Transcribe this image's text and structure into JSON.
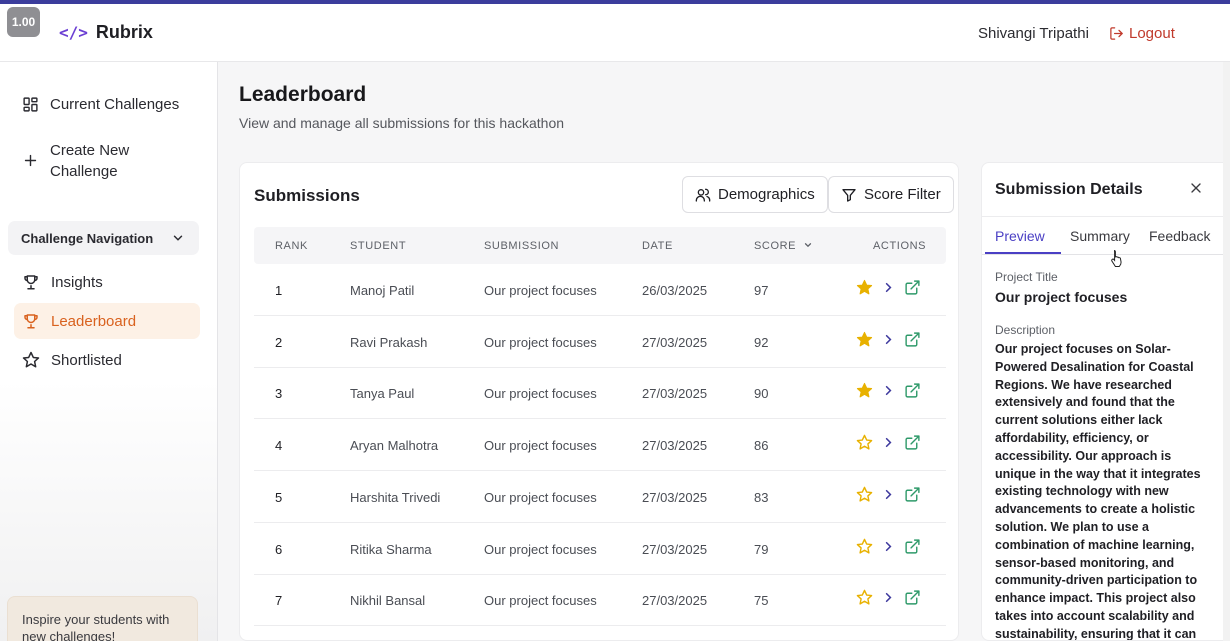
{
  "zoom": "1.00",
  "app": {
    "name": "Rubrix",
    "logo_glyph": "</>"
  },
  "header": {
    "user_name": "Shivangi Tripathi",
    "logout_label": "Logout"
  },
  "sidebar": {
    "current_challenges": "Current Challenges",
    "create_new_line1": "Create New",
    "create_new_line2": "Challenge",
    "nav_group_label": "Challenge Navigation",
    "items": [
      {
        "label": "Insights",
        "icon": "trophy-icon"
      },
      {
        "label": "Leaderboard",
        "icon": "trophy-icon",
        "active": true
      },
      {
        "label": "Shortlisted",
        "icon": "star-icon"
      }
    ],
    "promo_line1": "Inspire your students with",
    "promo_line2": "new challenges!"
  },
  "page": {
    "title": "Leaderboard",
    "subtitle": "View and manage all submissions for this hackathon"
  },
  "submissions": {
    "title": "Submissions",
    "demographics_label": "Demographics",
    "score_filter_label": "Score Filter",
    "columns": [
      "Rank",
      "Student",
      "Submission",
      "Date",
      "Score",
      "Actions"
    ],
    "rows": [
      {
        "rank": "1",
        "student": "Manoj Patil",
        "submission": "Our project focuses",
        "date": "26/03/2025",
        "score": "97",
        "starred": true
      },
      {
        "rank": "2",
        "student": "Ravi Prakash",
        "submission": "Our project focuses",
        "date": "27/03/2025",
        "score": "92",
        "starred": true
      },
      {
        "rank": "3",
        "student": "Tanya Paul",
        "submission": "Our project focuses",
        "date": "27/03/2025",
        "score": "90",
        "starred": true
      },
      {
        "rank": "4",
        "student": "Aryan Malhotra",
        "submission": "Our project focuses",
        "date": "27/03/2025",
        "score": "86",
        "starred": false
      },
      {
        "rank": "5",
        "student": "Harshita Trivedi",
        "submission": "Our project focuses",
        "date": "27/03/2025",
        "score": "83",
        "starred": false
      },
      {
        "rank": "6",
        "student": "Ritika Sharma",
        "submission": "Our project focuses",
        "date": "27/03/2025",
        "score": "79",
        "starred": false
      },
      {
        "rank": "7",
        "student": "Nikhil Bansal",
        "submission": "Our project focuses",
        "date": "27/03/2025",
        "score": "75",
        "starred": false
      }
    ]
  },
  "details": {
    "title": "Submission Details",
    "tabs": [
      "Preview",
      "Summary",
      "Feedback"
    ],
    "active_tab": "Preview",
    "project_title_label": "Project Title",
    "project_title": "Our project focuses",
    "description_label": "Description",
    "description": "Our project focuses on Solar-Powered Desalination for Coastal Regions. We have researched extensively and found that the current solutions either lack affordability, efficiency, or accessibility. Our approach is unique in the way that it integrates existing technology with new advancements to create a holistic solution. We plan to use a combination of machine learning, sensor-based monitoring, and community-driven participation to enhance impact. This project also takes into account scalability and sustainability, ensuring that it can be implemented in various regions"
  },
  "colors": {
    "accent": "#4a3fc4",
    "active_nav": "#d9621f",
    "logout": "#c0392b",
    "star": "#e8b100",
    "external_link": "#2f9a6a"
  }
}
